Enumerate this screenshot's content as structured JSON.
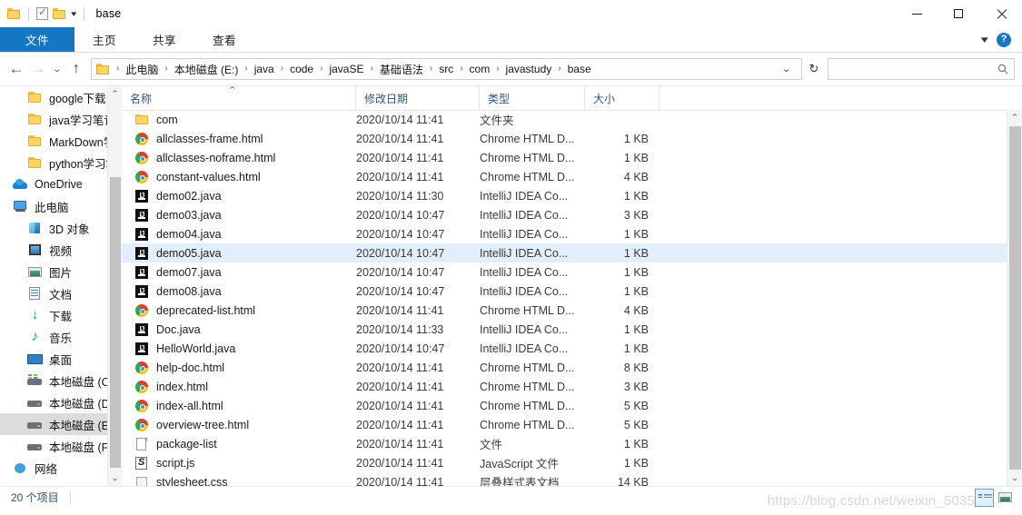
{
  "window": {
    "title": "base",
    "quick_access": [
      "folder-icon",
      "properties-icon",
      "new-folder-icon"
    ],
    "controls": {
      "minimize": "—",
      "maximize": "☐",
      "close": "✕"
    }
  },
  "ribbon": {
    "tabs": [
      {
        "label": "文件",
        "active": true
      },
      {
        "label": "主页",
        "active": false
      },
      {
        "label": "共享",
        "active": false
      },
      {
        "label": "查看",
        "active": false
      }
    ],
    "collapse_icon": "chevron-down-icon",
    "help_label": "?"
  },
  "address": {
    "back": "←",
    "forward": "→",
    "recent": "⌄",
    "up": "↑",
    "separator": "›",
    "crumbs": [
      "此电脑",
      "本地磁盘 (E:)",
      "java",
      "code",
      "javaSE",
      "基础语法",
      "src",
      "com",
      "javastudy",
      "base"
    ],
    "dropdown": "⌄",
    "refresh": "↻"
  },
  "search": {
    "value": "",
    "placeholder": "",
    "icon": "🔍"
  },
  "sidebar": {
    "scroll": {
      "up": "⌃",
      "down": "⌄"
    },
    "items": [
      {
        "label": "google下载",
        "icon": "folder-icon",
        "indent": 1,
        "selected": false
      },
      {
        "label": "java学习笔记",
        "icon": "folder-icon",
        "indent": 1,
        "selected": false
      },
      {
        "label": "MarkDown学习",
        "icon": "folder-icon",
        "indent": 1,
        "selected": false
      },
      {
        "label": "python学习笔记",
        "icon": "folder-icon",
        "indent": 1,
        "selected": false
      },
      {
        "label": "OneDrive",
        "icon": "onedrive-icon",
        "indent": 0,
        "selected": false
      },
      {
        "label": "此电脑",
        "icon": "this-pc-icon",
        "indent": 0,
        "selected": false
      },
      {
        "label": "3D 对象",
        "icon": "3d-objects-icon",
        "indent": 1,
        "selected": false
      },
      {
        "label": "视频",
        "icon": "videos-icon",
        "indent": 1,
        "selected": false
      },
      {
        "label": "图片",
        "icon": "pictures-icon",
        "indent": 1,
        "selected": false
      },
      {
        "label": "文档",
        "icon": "documents-icon",
        "indent": 1,
        "selected": false
      },
      {
        "label": "下载",
        "icon": "downloads-icon",
        "indent": 1,
        "selected": false
      },
      {
        "label": "音乐",
        "icon": "music-icon",
        "indent": 1,
        "selected": false
      },
      {
        "label": "桌面",
        "icon": "desktop-icon",
        "indent": 1,
        "selected": false
      },
      {
        "label": "本地磁盘 (C:)",
        "icon": "system-drive-icon",
        "indent": 1,
        "selected": false
      },
      {
        "label": "本地磁盘 (D:)",
        "icon": "drive-icon",
        "indent": 1,
        "selected": false
      },
      {
        "label": "本地磁盘 (E:)",
        "icon": "drive-icon",
        "indent": 1,
        "selected": true
      },
      {
        "label": "本地磁盘 (F:)",
        "icon": "drive-icon",
        "indent": 1,
        "selected": false
      },
      {
        "label": "网络",
        "icon": "network-icon",
        "indent": 0,
        "selected": false
      }
    ]
  },
  "filelist": {
    "columns": [
      {
        "key": "name",
        "label": "名称",
        "sorted": true,
        "sort_dir": "asc"
      },
      {
        "key": "date",
        "label": "修改日期",
        "sorted": false
      },
      {
        "key": "type",
        "label": "类型",
        "sorted": false
      },
      {
        "key": "size",
        "label": "大小",
        "sorted": false
      }
    ],
    "sort_caret": "⌃",
    "scroll": {
      "up": "⌃",
      "down": "⌄"
    },
    "rows": [
      {
        "name": "com",
        "date": "2020/10/14 11:41",
        "type": "文件夹",
        "size": "",
        "icon": "folder-icon",
        "selected": false
      },
      {
        "name": "allclasses-frame.html",
        "date": "2020/10/14 11:41",
        "type": "Chrome HTML D...",
        "size": "1 KB",
        "icon": "chrome-icon",
        "selected": false
      },
      {
        "name": "allclasses-noframe.html",
        "date": "2020/10/14 11:41",
        "type": "Chrome HTML D...",
        "size": "1 KB",
        "icon": "chrome-icon",
        "selected": false
      },
      {
        "name": "constant-values.html",
        "date": "2020/10/14 11:41",
        "type": "Chrome HTML D...",
        "size": "4 KB",
        "icon": "chrome-icon",
        "selected": false
      },
      {
        "name": "demo02.java",
        "date": "2020/10/14 11:30",
        "type": "IntelliJ IDEA Co...",
        "size": "1 KB",
        "icon": "intellij-icon",
        "selected": false
      },
      {
        "name": "demo03.java",
        "date": "2020/10/14 10:47",
        "type": "IntelliJ IDEA Co...",
        "size": "3 KB",
        "icon": "intellij-icon",
        "selected": false
      },
      {
        "name": "demo04.java",
        "date": "2020/10/14 10:47",
        "type": "IntelliJ IDEA Co...",
        "size": "1 KB",
        "icon": "intellij-icon",
        "selected": false
      },
      {
        "name": "demo05.java",
        "date": "2020/10/14 10:47",
        "type": "IntelliJ IDEA Co...",
        "size": "1 KB",
        "icon": "intellij-icon",
        "selected": true
      },
      {
        "name": "demo07.java",
        "date": "2020/10/14 10:47",
        "type": "IntelliJ IDEA Co...",
        "size": "1 KB",
        "icon": "intellij-icon",
        "selected": false
      },
      {
        "name": "demo08.java",
        "date": "2020/10/14 10:47",
        "type": "IntelliJ IDEA Co...",
        "size": "1 KB",
        "icon": "intellij-icon",
        "selected": false
      },
      {
        "name": "deprecated-list.html",
        "date": "2020/10/14 11:41",
        "type": "Chrome HTML D...",
        "size": "4 KB",
        "icon": "chrome-icon",
        "selected": false
      },
      {
        "name": "Doc.java",
        "date": "2020/10/14 11:33",
        "type": "IntelliJ IDEA Co...",
        "size": "1 KB",
        "icon": "intellij-icon",
        "selected": false
      },
      {
        "name": "HelloWorld.java",
        "date": "2020/10/14 10:47",
        "type": "IntelliJ IDEA Co...",
        "size": "1 KB",
        "icon": "intellij-icon",
        "selected": false
      },
      {
        "name": "help-doc.html",
        "date": "2020/10/14 11:41",
        "type": "Chrome HTML D...",
        "size": "8 KB",
        "icon": "chrome-icon",
        "selected": false
      },
      {
        "name": "index.html",
        "date": "2020/10/14 11:41",
        "type": "Chrome HTML D...",
        "size": "3 KB",
        "icon": "chrome-icon",
        "selected": false
      },
      {
        "name": "index-all.html",
        "date": "2020/10/14 11:41",
        "type": "Chrome HTML D...",
        "size": "5 KB",
        "icon": "chrome-icon",
        "selected": false
      },
      {
        "name": "overview-tree.html",
        "date": "2020/10/14 11:41",
        "type": "Chrome HTML D...",
        "size": "5 KB",
        "icon": "chrome-icon",
        "selected": false
      },
      {
        "name": "package-list",
        "date": "2020/10/14 11:41",
        "type": "文件",
        "size": "1 KB",
        "icon": "file-icon",
        "selected": false
      },
      {
        "name": "script.js",
        "date": "2020/10/14 11:41",
        "type": "JavaScript 文件",
        "size": "1 KB",
        "icon": "javascript-icon",
        "selected": false
      },
      {
        "name": "stylesheet.css",
        "date": "2020/10/14 11:41",
        "type": "层叠样式表文档",
        "size": "14 KB",
        "icon": "css-icon",
        "selected": false
      }
    ]
  },
  "statusbar": {
    "count_label": "20 个项目",
    "views": [
      {
        "name": "details-view",
        "active": true
      },
      {
        "name": "large-icons-view",
        "active": false
      }
    ]
  },
  "watermark": "https://blog.csdn.net/weixin_5035"
}
